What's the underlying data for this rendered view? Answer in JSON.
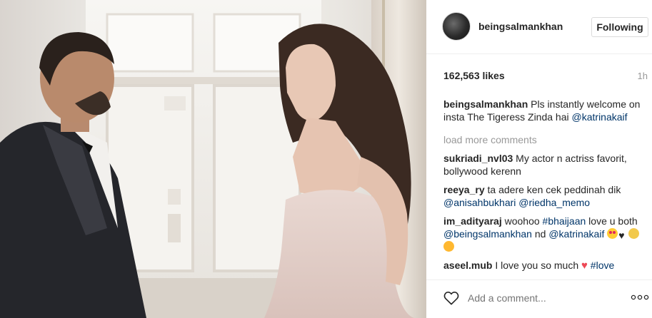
{
  "post": {
    "image_alt": "",
    "username": "beingsalmankhan",
    "follow_label": "Following",
    "likes": "162,563 likes",
    "time": "1h"
  },
  "caption": {
    "user": "beingsalmankhan",
    "text": "Pls instantly welcome on insta The Tigeress Zinda hai",
    "mention": "@katrinakaif"
  },
  "load_more_label": "load more comments",
  "comments": [
    {
      "user": "sukriadi_nvl03",
      "text": "My actor n actriss favorit, bollywood kerenn"
    },
    {
      "user": "reeya_ry",
      "text": "ta adere ken cek peddinah dik",
      "mentions": [
        "@anisahbukhari",
        "@riedha_memo"
      ]
    },
    {
      "user": "im_adityaraj",
      "text_parts": [
        "woohoo",
        "#bhaijaan",
        "love u both",
        "@beingsalmankhan",
        "nd",
        "@katrinakaif"
      ],
      "emojis": [
        "heart-eyes-emoji",
        "black-heart-emoji",
        "smile-emoji",
        "grin-emoji"
      ]
    },
    {
      "user": "aseel.mub",
      "text": "I love you so much",
      "hashtag": "#love",
      "emoji": "red-heart-emoji"
    }
  ],
  "footer": {
    "comment_placeholder": "Add a comment...",
    "like_icon": "heart-outline-icon",
    "more_icon": "more-options-icon"
  },
  "colors": {
    "link": "#003569",
    "muted": "#999999",
    "text": "#262626",
    "border": "#efefef"
  }
}
